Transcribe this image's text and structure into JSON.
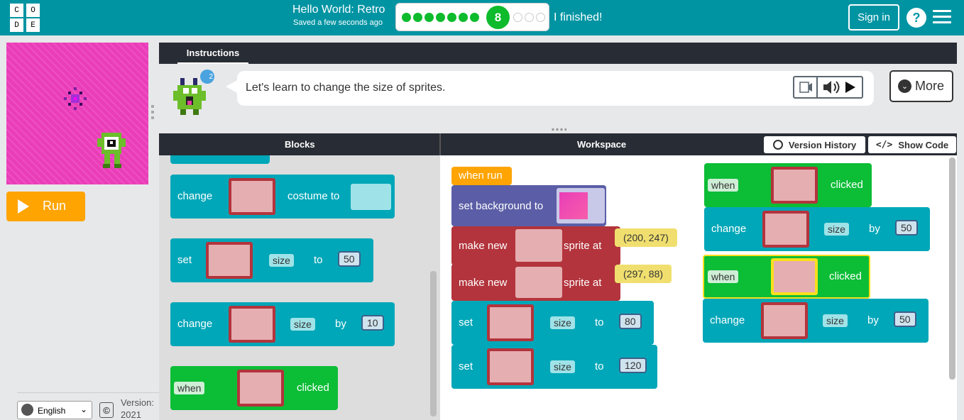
{
  "header": {
    "logo_letters": [
      "C",
      "O",
      "D",
      "E"
    ],
    "title": "Hello World: Retro",
    "saved": "Saved a few seconds ago",
    "current_level": "8",
    "finished": "I finished!",
    "sign_in": "Sign in",
    "help": "?"
  },
  "run_label": "Run",
  "instructions": {
    "tab": "Instructions",
    "badge": "2",
    "text": "Let's learn to change the size of sprites.",
    "more": "More"
  },
  "workspace_header": {
    "blocks": "Blocks",
    "workspace": "Workspace",
    "version_history": "Version History",
    "show_code": "Show Code"
  },
  "palette": {
    "b1": {
      "pre": "change",
      "mid": "costume to"
    },
    "b2": {
      "pre": "set",
      "drop": "size",
      "to": "to",
      "num": "50"
    },
    "b3": {
      "pre": "change",
      "drop": "size",
      "by": "by",
      "num": "10"
    },
    "b4": {
      "drop": "when",
      "post": "clicked"
    }
  },
  "ws": {
    "when_run": "when run",
    "bg": "set background to",
    "mk1": {
      "pre": "make new",
      "post": "sprite at",
      "coord": "(200, 247)"
    },
    "mk2": {
      "pre": "make new",
      "post": "sprite at",
      "coord": "(297, 88)"
    },
    "set1": {
      "pre": "set",
      "drop": "size",
      "to": "to",
      "num": "80"
    },
    "set2": {
      "pre": "set",
      "drop": "size",
      "to": "to",
      "num": "120"
    },
    "ev1": {
      "drop": "when",
      "post": "clicked"
    },
    "ch1": {
      "pre": "change",
      "drop": "size",
      "by": "by",
      "num": "50"
    },
    "ev2": {
      "drop": "when",
      "post": "clicked"
    },
    "ch2": {
      "pre": "change",
      "drop": "size",
      "by": "by",
      "num": "50"
    }
  },
  "footer": {
    "language": "English",
    "copyright": "©",
    "version_line1": "Version:",
    "version_line2": "2021"
  },
  "colors": {
    "header": "#0094a3",
    "run": "#ffa400",
    "sprite_block": "#00a7b8",
    "event_block": "#0cbd36",
    "make_block": "#b3343c",
    "bg_block": "#5b5ea6",
    "when_run": "#ffa400"
  }
}
